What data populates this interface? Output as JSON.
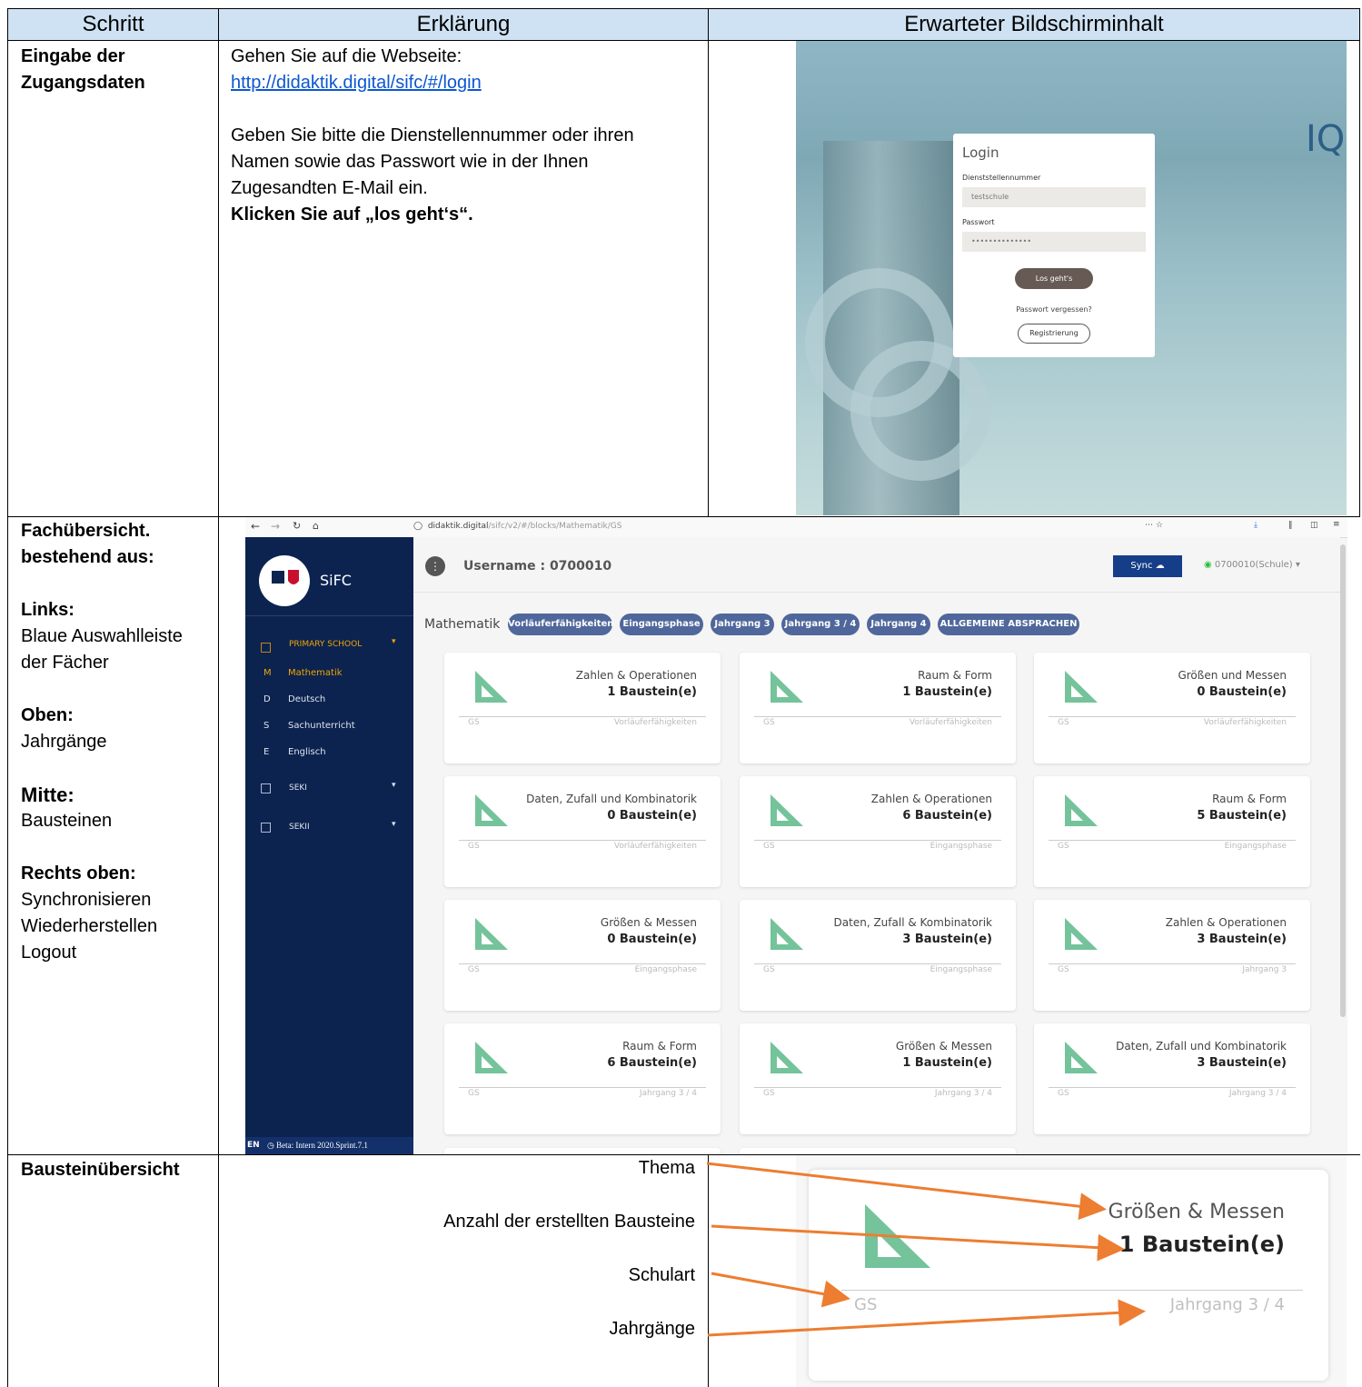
{
  "headers": {
    "step": "Schritt",
    "explanation": "Erklärung",
    "expected": "Erwarteter Bildschirminhalt"
  },
  "row1": {
    "step_line1": "Eingabe der",
    "step_line2": "Zugangsdaten",
    "expl_line1": "Gehen Sie auf die Webseite:",
    "link": "http://didaktik.digital/sifc/#/login",
    "expl_line2": "Geben Sie bitte die Dienstellennummer oder ihren",
    "expl_line3": "Namen sowie das Passwort wie in der Ihnen",
    "expl_line4": "Zugesandten E-Mail ein.",
    "expl_bold": "Klicken Sie auf „los geht‘s“.",
    "login": {
      "title": "Login",
      "id_label": "Dienststellennummer",
      "id_value": "testschule",
      "pw_label": "Passwort",
      "pw_value": "••••••••••••••",
      "submit": "Los geht's",
      "forgot": "Passwort vergessen?",
      "register": "Registrierung",
      "brand_fragment": "IQ"
    }
  },
  "row2": {
    "step_line1": "Fachübersicht.",
    "step_line2": "bestehend aus:",
    "links_h": "Links:",
    "links_1": "Blaue Auswahlleiste",
    "links_2": "der Fächer",
    "oben_h": "Oben:",
    "oben_1": "Jahrgänge",
    "mitte_h": "Mitte:",
    "mitte_1": "Bausteinen",
    "rechts_h": "Rechts oben:",
    "rechts_1": "Synchronisieren",
    "rechts_2": "Wiederherstellen",
    "rechts_3": "Logout",
    "browser": {
      "url_host": "didaktik.digital",
      "url_path": "/sifc/v2/#/blocks/Mathematik/GS",
      "app_name": "SiFC",
      "username": "Username : 0700010",
      "sync": "Sync",
      "account": "0700010(Schule)",
      "sidebar": {
        "group1": "PRIMARY SCHOOL",
        "subjects": [
          {
            "letter": "M",
            "name": "Mathematik"
          },
          {
            "letter": "D",
            "name": "Deutsch"
          },
          {
            "letter": "S",
            "name": "Sachunterricht"
          },
          {
            "letter": "E",
            "name": "Englisch"
          }
        ],
        "group2": "SEKI",
        "group3": "SEKII",
        "footer": "EN",
        "version": "Beta: Intern 2020.Sprint.7.1"
      },
      "subject": "Mathematik",
      "tabs": [
        "Vorläuferfähigkeiten",
        "Eingangsphase",
        "Jahrgang 3",
        "Jahrgang 3 / 4",
        "Jahrgang 4",
        "ALLGEMEINE ABSPRACHEN"
      ],
      "cards": [
        {
          "topic": "Zahlen & Operationen",
          "count": "1 Baustein(e)",
          "school": "GS",
          "grade": "Vorläuferfähigkeiten"
        },
        {
          "topic": "Raum & Form",
          "count": "1 Baustein(e)",
          "school": "GS",
          "grade": "Vorläuferfähigkeiten"
        },
        {
          "topic": "Größen und Messen",
          "count": "0 Baustein(e)",
          "school": "GS",
          "grade": "Vorläuferfähigkeiten"
        },
        {
          "topic": "Daten, Zufall und Kombinatorik",
          "count": "0 Baustein(e)",
          "school": "GS",
          "grade": "Vorläuferfähigkeiten"
        },
        {
          "topic": "Zahlen & Operationen",
          "count": "6 Baustein(e)",
          "school": "GS",
          "grade": "Eingangsphase"
        },
        {
          "topic": "Raum & Form",
          "count": "5 Baustein(e)",
          "school": "GS",
          "grade": "Eingangsphase"
        },
        {
          "topic": "Größen & Messen",
          "count": "0 Baustein(e)",
          "school": "GS",
          "grade": "Eingangsphase"
        },
        {
          "topic": "Daten, Zufall & Kombinatorik",
          "count": "3 Baustein(e)",
          "school": "GS",
          "grade": "Eingangsphase"
        },
        {
          "topic": "Zahlen & Operationen",
          "count": "3 Baustein(e)",
          "school": "GS",
          "grade": "Jahrgang 3"
        },
        {
          "topic": "Raum & Form",
          "count": "6 Baustein(e)",
          "school": "GS",
          "grade": "Jahrgang 3 / 4"
        },
        {
          "topic": "Größen & Messen",
          "count": "1 Baustein(e)",
          "school": "GS",
          "grade": "Jahrgang 3 / 4"
        },
        {
          "topic": "Daten, Zufall und Kombinatorik",
          "count": "3 Baustein(e)",
          "school": "GS",
          "grade": "Jahrgang 3 / 4"
        }
      ]
    }
  },
  "row3": {
    "step": "Bausteinübersicht",
    "annotations": [
      "Thema",
      "Anzahl der erstellten Bausteine",
      "Schulart",
      "Jahrgänge"
    ],
    "card": {
      "topic": "Größen & Messen",
      "count": "1 Baustein(e)",
      "school": "GS",
      "grade": "Jahrgang 3 / 4"
    },
    "arrow_color": "#ed7d31"
  }
}
